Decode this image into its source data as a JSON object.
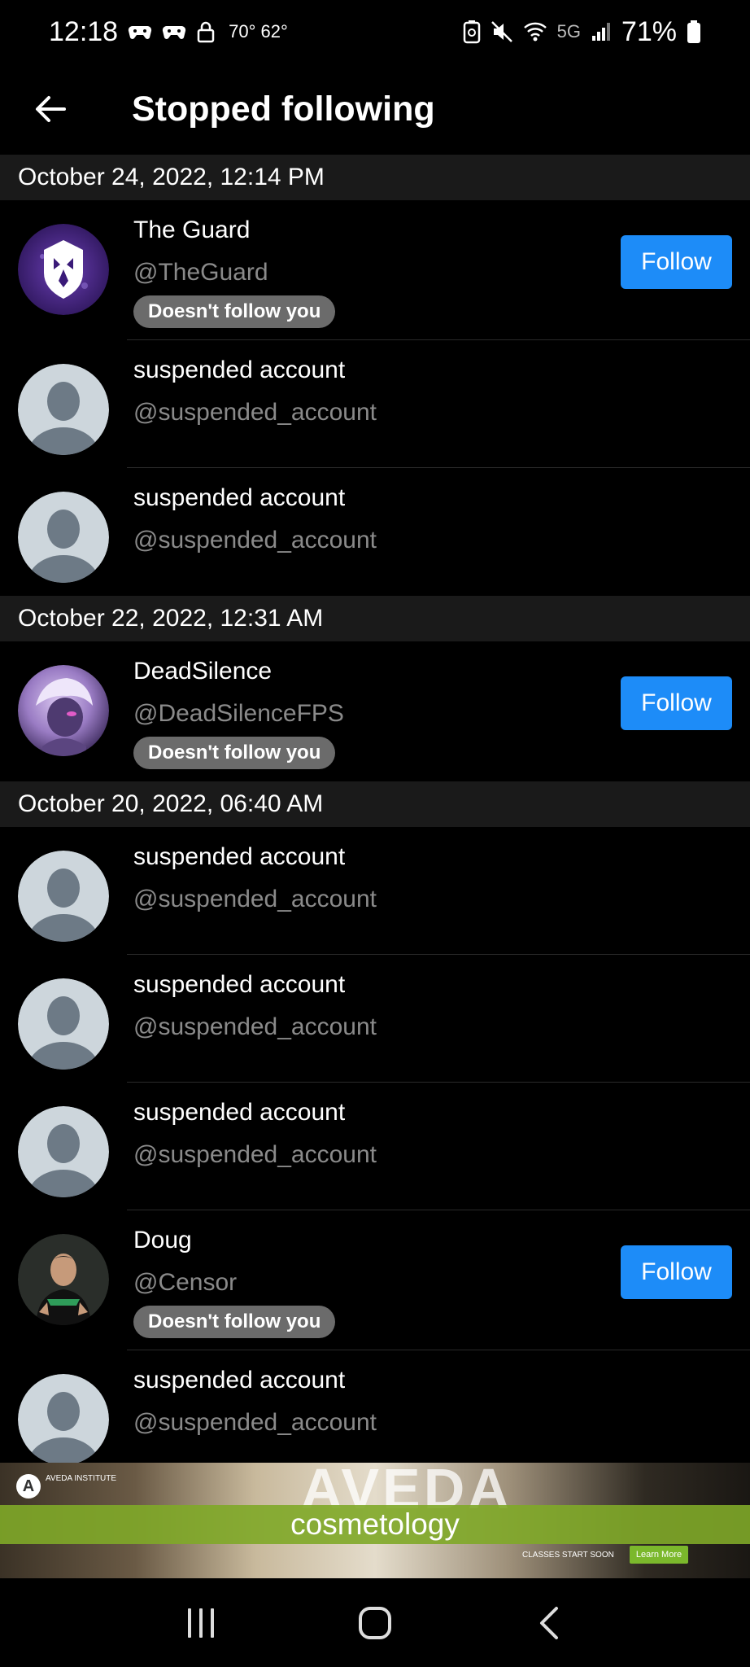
{
  "status_bar": {
    "time": "12:18",
    "temps": "70° 62°",
    "network": "5G",
    "battery": "71%",
    "icons": [
      "gamepad-icon",
      "gamepad-icon",
      "lock-icon",
      "battery-saver-icon",
      "mute-icon",
      "wifi-icon",
      "signal-icon",
      "battery-icon"
    ]
  },
  "header": {
    "title": "Stopped following",
    "back_icon": "back-arrow-icon"
  },
  "groups": [
    {
      "date": "October 24, 2022, 12:14 PM",
      "items": [
        {
          "name": "The Guard",
          "handle": "@TheGuard",
          "badge": "Doesn't follow you",
          "button": "Follow",
          "avatar": "the-guard"
        },
        {
          "name": "suspended account",
          "handle": "@suspended_account",
          "avatar": "default"
        },
        {
          "name": "suspended account",
          "handle": "@suspended_account",
          "avatar": "default"
        }
      ]
    },
    {
      "date": "October 22, 2022, 12:31 AM",
      "items": [
        {
          "name": "DeadSilence",
          "handle": "@DeadSilenceFPS",
          "badge": "Doesn't follow you",
          "button": "Follow",
          "avatar": "deadsilence"
        }
      ]
    },
    {
      "date": "October 20, 2022, 06:40 AM",
      "items": [
        {
          "name": "suspended account",
          "handle": "@suspended_account",
          "avatar": "default"
        },
        {
          "name": "suspended account",
          "handle": "@suspended_account",
          "avatar": "default"
        },
        {
          "name": "suspended account",
          "handle": "@suspended_account",
          "avatar": "default"
        },
        {
          "name": "Doug",
          "handle": "@Censor",
          "badge": "Doesn't follow you",
          "button": "Follow",
          "avatar": "doug"
        },
        {
          "name": "suspended account",
          "handle": "@suspended_account",
          "avatar": "default"
        }
      ]
    }
  ],
  "ad": {
    "brand": "AVEDA",
    "headline": "cosmetology",
    "small_text": "AVEDA INSTITUTE",
    "subtext": "CLASSES START SOON",
    "cta": "Learn More"
  },
  "nav": {
    "recents_icon": "recents-icon",
    "home_icon": "home-icon",
    "back_icon": "back-icon"
  },
  "colors": {
    "accent": "#1d8cf8",
    "badge": "#6b6b6b",
    "date_band": "#1a1a1a",
    "handle": "#8a8a8a"
  }
}
